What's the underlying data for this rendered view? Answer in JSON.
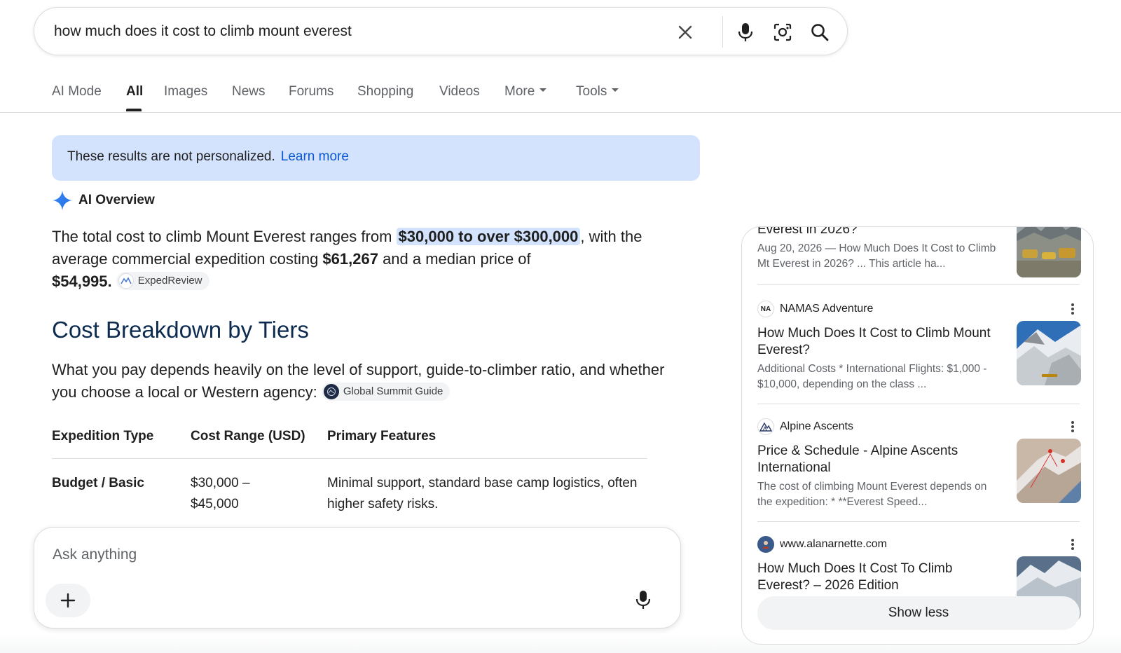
{
  "search": {
    "query": "how much does it cost to climb mount everest"
  },
  "tabs": [
    {
      "label": "AI Mode"
    },
    {
      "label": "All"
    },
    {
      "label": "Images"
    },
    {
      "label": "News"
    },
    {
      "label": "Forums"
    },
    {
      "label": "Shopping"
    },
    {
      "label": "Videos"
    },
    {
      "label": "More"
    },
    {
      "label": "Tools"
    }
  ],
  "notice": {
    "text": "These results are not personalized.",
    "link": "Learn more"
  },
  "ai_overview": {
    "label": "AI Overview",
    "p1_a": "The total cost to climb Mount Everest ranges from ",
    "p1_hl": "$30,000 to over $300,000",
    "p1_b": ", with the average commercial expedition costing ",
    "p1_avg": "$61,267",
    "p1_c": " and a median price of ",
    "p1_median": "$54,995",
    "p1_d": ".",
    "chip1": "ExpedReview",
    "heading": "Cost Breakdown by Tiers",
    "p2": "What you pay depends heavily on the level of support, guide-to-climber ratio, and whether you choose a local or Western agency:",
    "chip2": "Global Summit Guide",
    "table": {
      "headers": [
        "Expedition Type",
        "Cost Range (USD)",
        "Primary Features"
      ],
      "rows": [
        [
          "Budget / Basic",
          "$30,000 – $45,000",
          "Minimal support, standard base camp logistics, often higher safety risks."
        ]
      ]
    }
  },
  "ask": {
    "placeholder": "Ask anything"
  },
  "sources": [
    {
      "title": "Everest in 2026?",
      "snippet": "Aug 20, 2026 — How Much Does It Cost to Climb Mt Everest in 2026? ... This article ha..."
    },
    {
      "site": "NAMAS Adventure",
      "favicon": "NA",
      "title": "How Much Does It Cost to Climb Mount Everest?",
      "snippet": "Additional Costs * International Flights: $1,000 - $10,000, depending on the class ..."
    },
    {
      "site": "Alpine Ascents",
      "title": "Price & Schedule - Alpine Ascents International",
      "snippet": "The cost of climbing Mount Everest depends on the expedition: * **Everest Speed..."
    },
    {
      "site": "www.alanarnette.com",
      "title": "How Much Does It Cost To Climb Everest? – 2026 Edition"
    }
  ],
  "show_less": "Show less",
  "colors": {
    "accent_blue": "#0b57d0",
    "highlight": "#d3e3fd",
    "heading_navy": "#0d2b4f",
    "muted": "#5f6368"
  },
  "icons": {
    "clear": "close-icon",
    "voice": "microphone-icon",
    "lens": "lens-camera-icon",
    "search": "search-icon",
    "ai": "sparkle-icon",
    "add": "plus-icon"
  }
}
